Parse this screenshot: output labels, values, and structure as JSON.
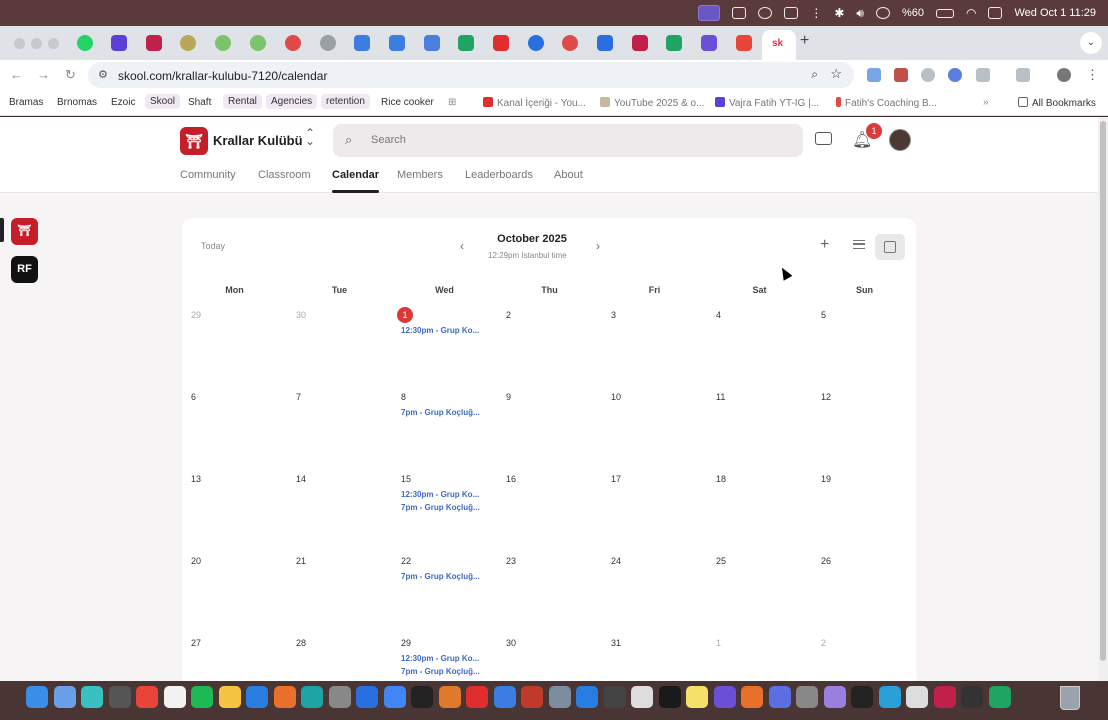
{
  "menubar": {
    "battery": "%60",
    "datetime": "Wed Oct 1  11:29"
  },
  "browser": {
    "active_tab_label": "sk",
    "url": "skool.com/krallar-kulubu-7120/calendar",
    "bookmarks": [
      "Bramas",
      "Brnomas",
      "Ezoic",
      "Skool",
      "Shaft",
      "Rental",
      "Agencies",
      "retention",
      "Rice cooker"
    ],
    "bookmark_links": [
      "Kanal İçeriği - You...",
      "YouTube 2025 & o...",
      "Vajra Fatih YT-IG |...",
      "Fatih's Coaching B..."
    ],
    "more": "»",
    "all_bookmarks": "All Bookmarks"
  },
  "group": {
    "name": "Krallar Kulübü",
    "search_placeholder": "Search",
    "notifications": "1"
  },
  "nav_tabs": [
    "Community",
    "Classroom",
    "Calendar",
    "Members",
    "Leaderboards",
    "About"
  ],
  "active_tab": "Calendar",
  "sidebar_groups": [
    {
      "name": "krallar-kulubu",
      "color": "#c41e2a",
      "glyph": "⛩"
    },
    {
      "name": "rf",
      "color": "#111111",
      "glyph": "RF"
    }
  ],
  "calendar": {
    "today_label": "Today",
    "month_label": "October 2025",
    "timezone_label": "12:29pm Istanbul time",
    "weekdays": [
      "Mon",
      "Tue",
      "Wed",
      "Thu",
      "Fri",
      "Sat",
      "Sun"
    ],
    "weeks": [
      [
        {
          "d": "29",
          "m": true
        },
        {
          "d": "30",
          "m": true
        },
        {
          "d": "1",
          "today": true,
          "ev": [
            "12:30pm - Grup Ko..."
          ]
        },
        {
          "d": "2"
        },
        {
          "d": "3"
        },
        {
          "d": "4"
        },
        {
          "d": "5"
        }
      ],
      [
        {
          "d": "6"
        },
        {
          "d": "7"
        },
        {
          "d": "8",
          "ev": [
            "7pm - Grup Koçluğ..."
          ]
        },
        {
          "d": "9"
        },
        {
          "d": "10"
        },
        {
          "d": "11"
        },
        {
          "d": "12"
        }
      ],
      [
        {
          "d": "13"
        },
        {
          "d": "14"
        },
        {
          "d": "15",
          "ev": [
            "12:30pm - Grup Ko...",
            "7pm - Grup Koçluğ..."
          ]
        },
        {
          "d": "16"
        },
        {
          "d": "17"
        },
        {
          "d": "18"
        },
        {
          "d": "19"
        }
      ],
      [
        {
          "d": "20"
        },
        {
          "d": "21"
        },
        {
          "d": "22",
          "ev": [
            "7pm - Grup Koçluğ..."
          ]
        },
        {
          "d": "23"
        },
        {
          "d": "24"
        },
        {
          "d": "25"
        },
        {
          "d": "26"
        }
      ],
      [
        {
          "d": "27"
        },
        {
          "d": "28"
        },
        {
          "d": "29",
          "ev": [
            "12:30pm - Grup Ko...",
            "7pm - Grup Koçluğ..."
          ]
        },
        {
          "d": "30"
        },
        {
          "d": "31"
        },
        {
          "d": "1",
          "m": true
        },
        {
          "d": "2",
          "m": true
        }
      ]
    ]
  },
  "colors": {
    "accent_event": "#3f68c8",
    "today": "#d9393a",
    "brand": "#c41e2a"
  }
}
